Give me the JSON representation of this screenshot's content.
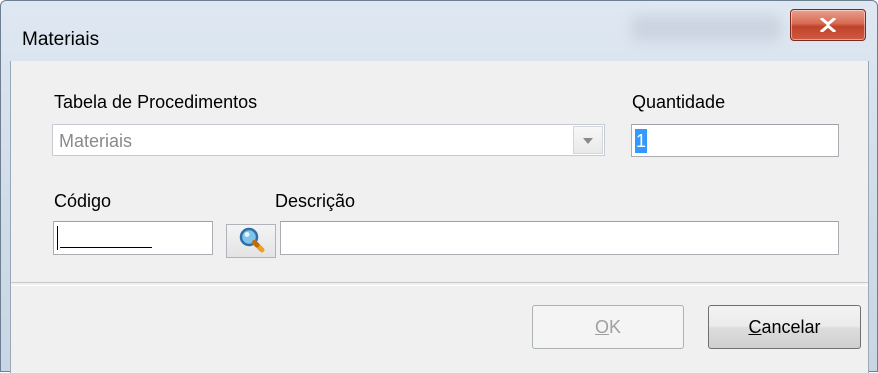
{
  "window": {
    "title": "Materiais",
    "close_glyph": "X"
  },
  "form": {
    "tabela_label": "Tabela de Procedimentos",
    "tabela_value": "Materiais",
    "quantidade_label": "Quantidade",
    "quantidade_value": "1",
    "codigo_label": "Código",
    "codigo_value": "",
    "descricao_label": "Descrição",
    "descricao_value": ""
  },
  "buttons": {
    "ok_accel": "O",
    "ok_rest": "K",
    "cancel_accel": "C",
    "cancel_rest": "ancelar"
  },
  "icons": {
    "close": "close-icon",
    "dropdown": "chevron-down-icon",
    "lookup": "magnifier-icon"
  },
  "colors": {
    "close_button": "#c0432b",
    "selection": "#3399ff",
    "window_frame": "#cfdbe8",
    "client_bg": "#f0f0f0"
  }
}
